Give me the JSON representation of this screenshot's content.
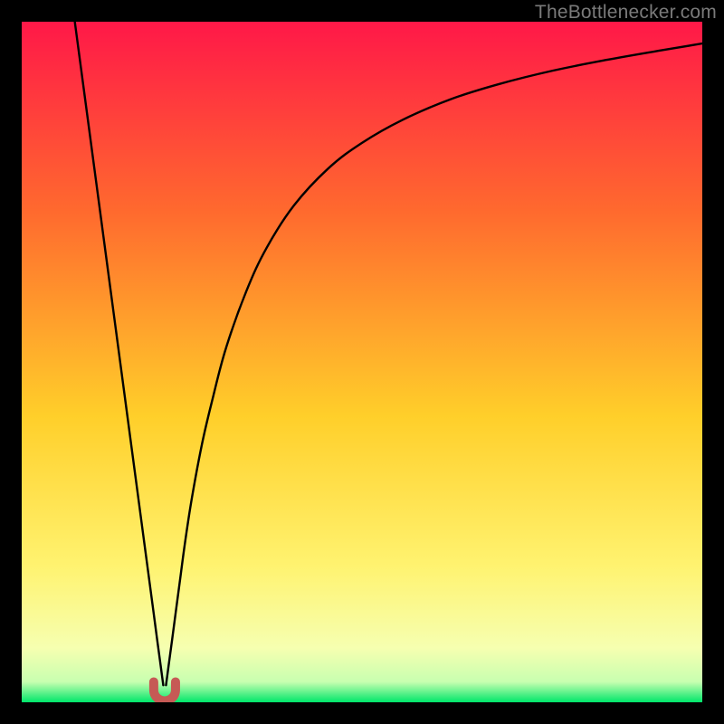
{
  "watermark": "TheBottlenecker.com",
  "colors": {
    "frame": "#000000",
    "gradient_top": "#ff1848",
    "gradient_mid_upper": "#ff6a2e",
    "gradient_mid": "#ffcf2a",
    "gradient_mid_lower": "#fff370",
    "gradient_low": "#f6ffb0",
    "gradient_bottom": "#00e66a",
    "curve": "#000000",
    "marker": "#c65a55"
  },
  "chart_data": {
    "type": "line",
    "title": "",
    "xlabel": "",
    "ylabel": "",
    "xlim": [
      0,
      100
    ],
    "ylim": [
      0,
      100
    ],
    "notch_x": 21,
    "series": [
      {
        "name": "left-branch",
        "x": [
          7.8,
          9,
          10,
          11,
          12,
          13,
          14,
          15,
          16,
          17,
          18,
          18.8,
          19.4,
          19.9,
          20.4,
          20.8
        ],
        "y": [
          100,
          91,
          83.5,
          76,
          68.5,
          61,
          53.5,
          46,
          38.5,
          31,
          23.5,
          17.5,
          13,
          9.2,
          5.5,
          2.5
        ]
      },
      {
        "name": "right-branch",
        "x": [
          21.2,
          21.6,
          22.1,
          22.6,
          23.2,
          24,
          25,
          26.5,
          28,
          30,
          33,
          36,
          40,
          45,
          50,
          56,
          63,
          70,
          78,
          86,
          94,
          100
        ],
        "y": [
          2.5,
          5.5,
          9.2,
          13,
          17.5,
          23.5,
          30,
          38,
          44.4,
          52,
          60.4,
          66.8,
          73,
          78.4,
          82.2,
          85.6,
          88.6,
          90.8,
          92.8,
          94.4,
          95.8,
          96.8
        ]
      }
    ],
    "marker": {
      "name": "u-notch",
      "x": 21,
      "width": 3.2,
      "depth": 3.0
    }
  }
}
